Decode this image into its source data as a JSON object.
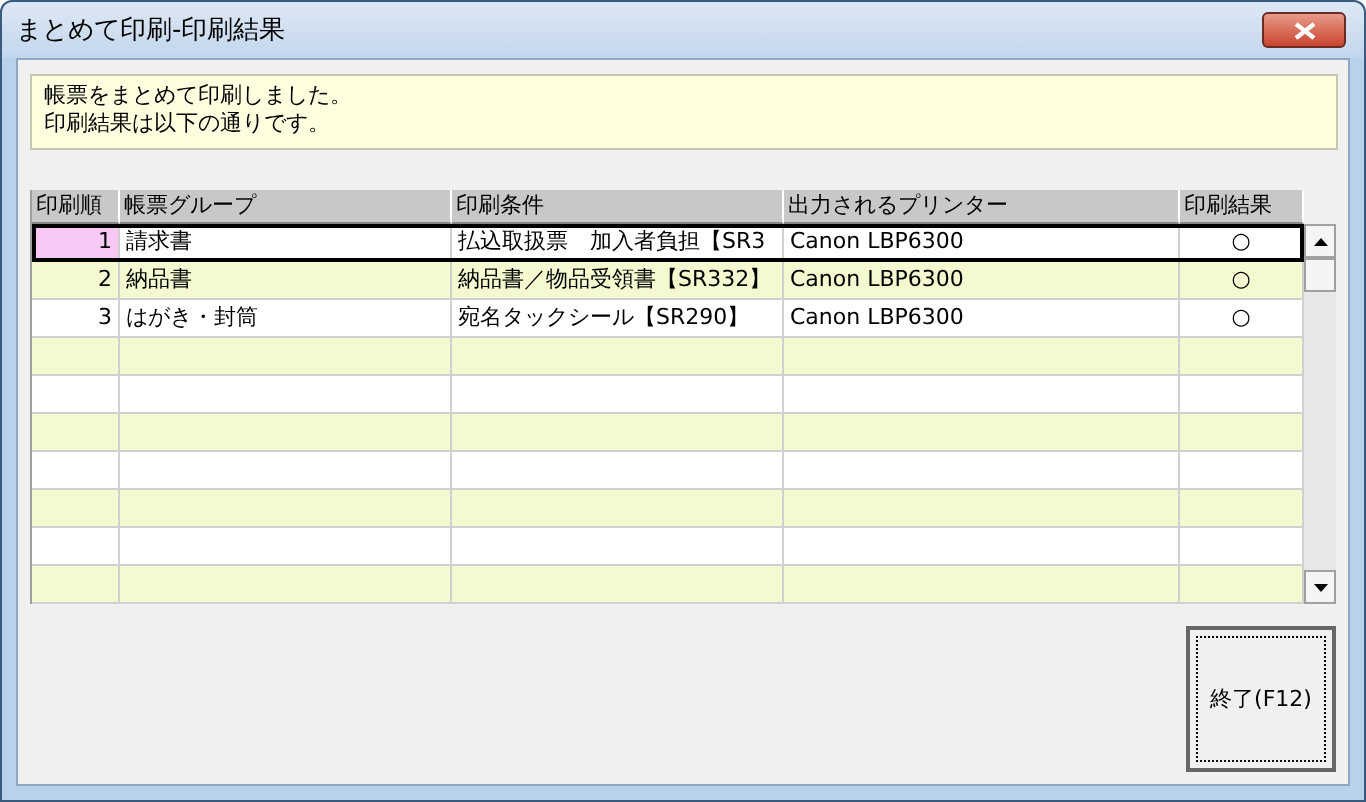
{
  "window": {
    "title": "まとめて印刷-印刷結果"
  },
  "message": [
    "帳票をまとめて印刷しました。",
    "印刷結果は以下の通りです。"
  ],
  "table": {
    "columns": [
      "印刷順",
      "帳票グループ",
      "印刷条件",
      "出力されるプリンター",
      "印刷結果"
    ],
    "rows": [
      {
        "cells": [
          "1",
          "請求書",
          "払込取扱票　加入者負担【SR3",
          "Canon LBP6300",
          "○"
        ],
        "selected": true
      },
      {
        "cells": [
          "2",
          "納品書",
          "納品書／物品受領書【SR332】",
          "Canon LBP6300",
          "○"
        ],
        "selected": false
      },
      {
        "cells": [
          "3",
          "はがき・封筒",
          "宛名タックシール【SR290】",
          "Canon LBP6300",
          "○"
        ],
        "selected": false
      }
    ]
  },
  "close_button": "終了(F12)"
}
